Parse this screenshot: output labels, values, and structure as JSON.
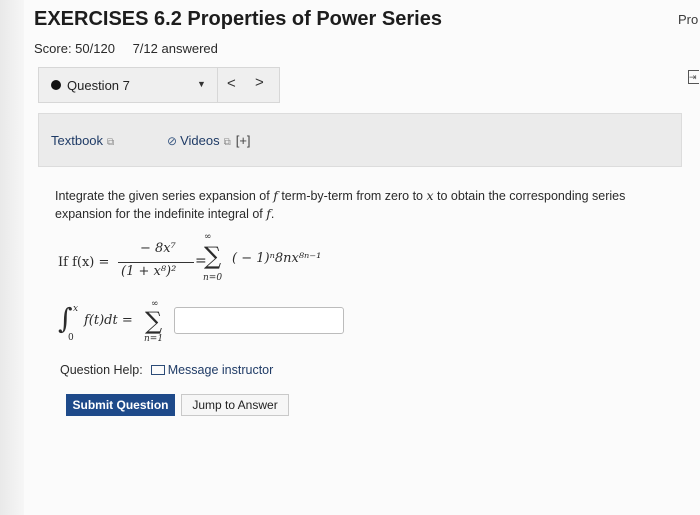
{
  "header": {
    "title": "EXERCISES 6.2 Properties of Power Series",
    "score": "Score: 50/120",
    "answered": "7/12 answered",
    "corner_label": "Pro"
  },
  "question_nav": {
    "current": "Question 7",
    "prev_glyph": "<",
    "next_glyph": ">"
  },
  "resources": {
    "textbook": "Textbook",
    "videos": "Videos",
    "videos_extra": "[+]"
  },
  "question": {
    "prompt_1": "Integrate the given series expansion of ",
    "prompt_f": "f",
    "prompt_2": " term-by-term from zero to ",
    "prompt_x": "x",
    "prompt_3": " to obtain the corresponding series expansion for the indefinite integral of ",
    "prompt_f2": "f",
    "prompt_end": ".",
    "if_label": "If f(x) =",
    "numerator": "− 8x⁷",
    "denominator": "(1 + x⁸)²",
    "equals": "=",
    "sigma": "∑",
    "sum_top": "∞",
    "sum_bottom": "n=0",
    "sum_term": "( − 1)ⁿ8nx⁸ⁿ⁻¹",
    "integral_sign": "∫",
    "int_upper": "x",
    "int_lower": "0",
    "integrand": "f(t)dt =",
    "sum2_top": "∞",
    "sum2_bottom": "n=1",
    "answer_value": ""
  },
  "help": {
    "label": "Question Help:",
    "message": "Message instructor"
  },
  "actions": {
    "submit": "Submit Question",
    "jump": "Jump to Answer"
  },
  "icons": {
    "question_status": "dot-icon",
    "external_link": "external-link-icon",
    "paperclip": "paperclip-icon",
    "mail": "mail-icon"
  }
}
